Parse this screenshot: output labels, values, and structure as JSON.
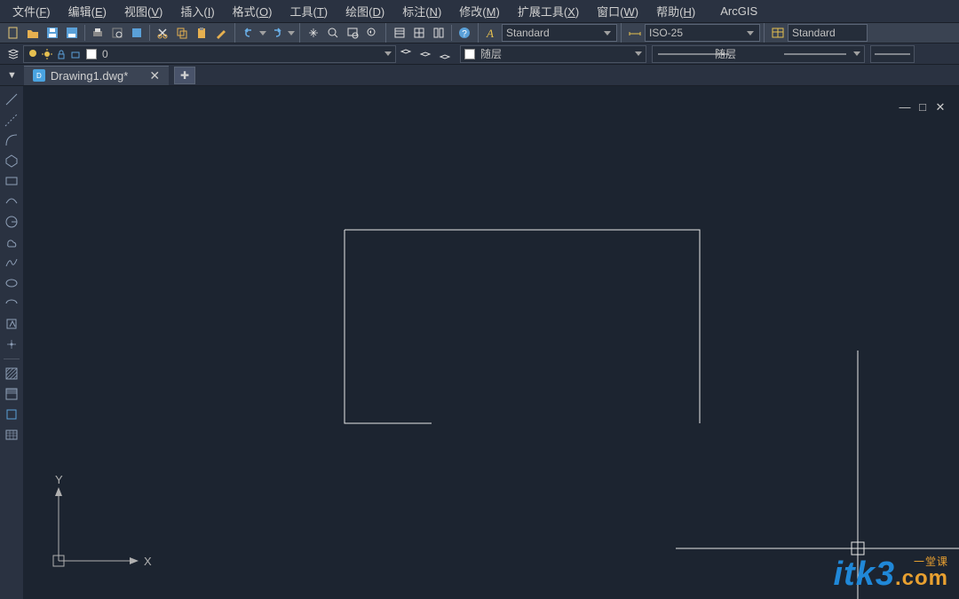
{
  "menu": {
    "file": "文件(F)",
    "edit": "编辑(E)",
    "view": "视图(V)",
    "insert": "插入(I)",
    "format": "格式(O)",
    "tools": "工具(T)",
    "draw": "绘图(D)",
    "annotate": "标注(N)",
    "modify": "修改(M)",
    "extend": "扩展工具(X)",
    "window": "窗口(W)",
    "help": "帮助(H)",
    "arcgis": "ArcGIS"
  },
  "toolbar": {
    "text_style": "Standard",
    "dim_style": "ISO-25",
    "table_style": "Standard"
  },
  "layer": {
    "current": "0",
    "bylayer1": "随层",
    "bylayer2": "随层"
  },
  "tab": {
    "name": "Drawing1.dwg*"
  },
  "ucs": {
    "y": "Y",
    "x": "X"
  },
  "watermark": {
    "brand": "itk3",
    "dom": ".com",
    "cn": "一堂课"
  }
}
